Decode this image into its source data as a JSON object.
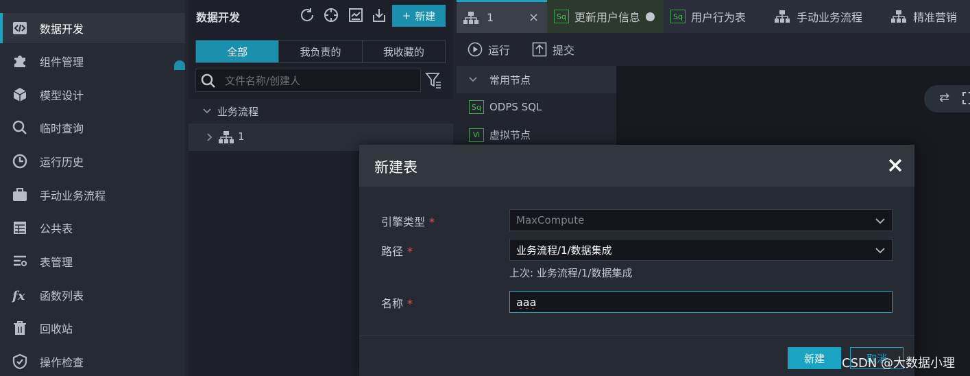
{
  "nav": {
    "items": [
      {
        "label": "数据开发",
        "icon": "code-icon",
        "active": true
      },
      {
        "label": "组件管理",
        "icon": "puzzle-icon"
      },
      {
        "label": "模型设计",
        "icon": "cube-icon"
      },
      {
        "label": "临时查询",
        "icon": "search-icon"
      },
      {
        "label": "运行历史",
        "icon": "clock-icon"
      },
      {
        "label": "手动业务流程",
        "icon": "briefcase-icon"
      },
      {
        "label": "公共表",
        "icon": "table-icon"
      },
      {
        "label": "表管理",
        "icon": "table-settings-icon"
      },
      {
        "label": "函数列表",
        "icon": "fx-icon"
      },
      {
        "label": "回收站",
        "icon": "trash-icon"
      },
      {
        "label": "操作检查",
        "icon": "shield-icon"
      }
    ]
  },
  "files": {
    "title": "数据开发",
    "new_label": "新建",
    "tabs": [
      "全部",
      "我负责的",
      "我收藏的"
    ],
    "search_placeholder": "文件名称/创建人",
    "tree_root": "业务流程",
    "tree_child": "1"
  },
  "editor": {
    "tabs": [
      {
        "label": "1",
        "kind": "workflow"
      },
      {
        "label": "更新用户信息",
        "kind": "sql",
        "badge": "Sq"
      },
      {
        "label": "用户行为表",
        "kind": "sql",
        "badge": "Sq"
      },
      {
        "label": "手动业务流程",
        "kind": "workflow"
      },
      {
        "label": "精准营销",
        "kind": "workflow"
      }
    ],
    "toolbar": {
      "run": "运行",
      "submit": "提交"
    },
    "nodes": {
      "header": "常用节点",
      "items": [
        {
          "badge": "Sq",
          "label": "ODPS SQL"
        },
        {
          "badge": "Vi",
          "label": "虚拟节点"
        }
      ]
    }
  },
  "modal": {
    "title": "新建表",
    "engine_label": "引擎类型",
    "engine_value": "MaxCompute",
    "path_label": "路径",
    "path_value": "业务流程/1/数据集成",
    "hint": "上次: 业务流程/1/数据集成",
    "name_label": "名称",
    "name_value": "aaa",
    "required_mark": "*",
    "confirm_label": "新建",
    "cancel_label": "取消"
  },
  "watermark": "CSDN @大数据小理",
  "colors": {
    "accent": "#1ba3c4",
    "required": "#e84a4a",
    "sql_badge": "#4fbf5c"
  }
}
